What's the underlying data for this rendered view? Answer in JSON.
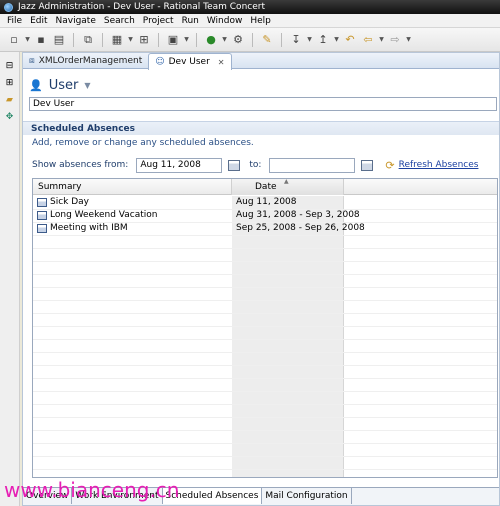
{
  "window": {
    "title": "Jazz Administration - Dev User - Rational Team Concert"
  },
  "menubar": {
    "items": [
      "File",
      "Edit",
      "Navigate",
      "Search",
      "Project",
      "Run",
      "Window",
      "Help"
    ]
  },
  "editor_tabs": [
    {
      "label": "XMLOrderManagement",
      "active": false
    },
    {
      "label": "Dev User",
      "active": true
    }
  ],
  "header": {
    "title": "User"
  },
  "user": {
    "name": "Dev User"
  },
  "section": {
    "title": "Scheduled Absences",
    "description": "Add, remove or change any scheduled absences."
  },
  "filter": {
    "from_label": "Show absences from:",
    "from_value": "Aug 11, 2008",
    "to_label": "to:",
    "to_value": "",
    "refresh_label": "Refresh Absences"
  },
  "table": {
    "columns": [
      "Summary",
      "Date"
    ],
    "rows": [
      {
        "summary": "Sick Day",
        "date": "Aug 11, 2008"
      },
      {
        "summary": "Long Weekend Vacation",
        "date": "Aug 31, 2008 - Sep 3, 2008"
      },
      {
        "summary": "Meeting with IBM",
        "date": "Sep 25, 2008 - Sep 26, 2008"
      }
    ]
  },
  "bottom_tabs": [
    "Overview",
    "Work Environment",
    "Scheduled Absences",
    "Mail Configuration"
  ],
  "bottom_tabs_active": "Scheduled Absences",
  "watermark": {
    "text": "www.bianceng.cn"
  },
  "colors": {
    "accent": "#1f3d6b",
    "link": "#1a3fa0",
    "watermark": "#e61eb4"
  }
}
